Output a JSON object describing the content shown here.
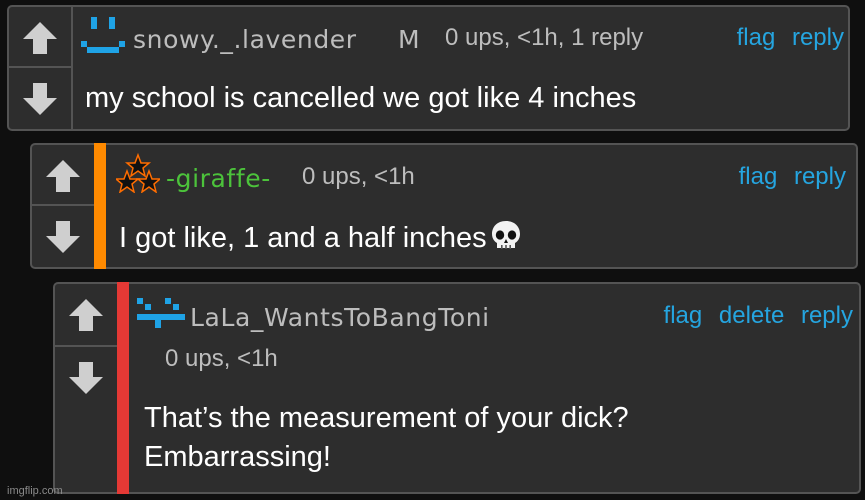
{
  "comments": [
    {
      "username": "snowy._.lavender",
      "gender": "M",
      "meta": "0 ups, <1h, 1 reply",
      "actions": [
        "flag",
        "reply"
      ],
      "text": "my school is cancelled we got like 4 inches",
      "avatar_icon": "blue-smiley-avatar"
    },
    {
      "username": "-giraffe-",
      "meta": "0 ups, <1h",
      "actions": [
        "flag",
        "reply"
      ],
      "text": "I got like, 1 and a half inches",
      "emoji_icon": "skull-emoji",
      "avatar_icon": "stars-avatar",
      "thread_color": "#ff8a00"
    },
    {
      "username": "LaLa_WantsToBangToni",
      "meta": "0 ups, <1h",
      "actions": [
        "flag",
        "delete",
        "reply"
      ],
      "text_lines": [
        "That’s the measurement of your dick?",
        "Embarrassing!"
      ],
      "avatar_icon": "blue-pixel-face-avatar",
      "thread_color": "#e53935"
    }
  ],
  "watermark": "imgflip.com",
  "colors": {
    "link": "#25a5e0",
    "username_green": "#4cc33b",
    "avatar_blue": "#1fa3e6"
  }
}
